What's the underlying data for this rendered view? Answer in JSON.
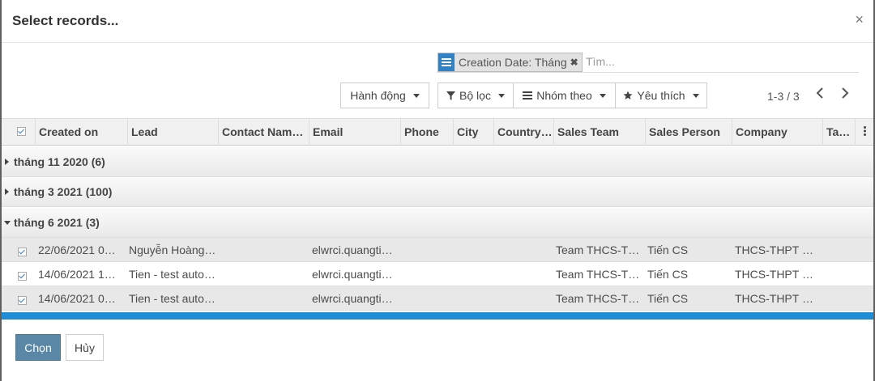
{
  "dialog": {
    "title": "Select records...",
    "close_glyph": "×"
  },
  "search": {
    "facet_label": "Creation Date: Tháng",
    "facet_remove": "✖",
    "placeholder": "Tìm..."
  },
  "toolbar": {
    "action": "Hành động",
    "filter": "Bộ lọc",
    "group_by": "Nhóm theo",
    "favorites": "Yêu thích"
  },
  "pager": {
    "value": "1-3 / 3",
    "prev": "‹",
    "next": "›"
  },
  "columns": [
    "Created on",
    "Lead",
    "Contact Name…",
    "Email",
    "Phone",
    "City",
    "Country…",
    "Sales Team",
    "Sales Person",
    "Company",
    "Ta…"
  ],
  "groups": [
    {
      "label": "tháng 11 2020 (6)",
      "expanded": false
    },
    {
      "label": "tháng 3 2021 (100)",
      "expanded": false
    },
    {
      "label": "tháng 6 2021 (3)",
      "expanded": true
    }
  ],
  "rows": [
    {
      "selected": true,
      "created_on": "22/06/2021 0…",
      "lead": "Nguyễn Hoàng…",
      "email": "elwrci.quangti…",
      "sales_team": "Team THCS-T…",
      "sales_person": "Tiến CS",
      "company": "THCS-THPT B…"
    },
    {
      "selected": true,
      "created_on": "14/06/2021 1…",
      "lead": "Tien - test auto…",
      "email": "elwrci.quangti…",
      "sales_team": "Team THCS-T…",
      "sales_person": "Tiến CS",
      "company": "THCS-THPT B…"
    },
    {
      "selected": true,
      "created_on": "14/06/2021 0…",
      "lead": "Tien - test auto…",
      "email": "elwrci.quangti…",
      "sales_team": "Team THCS-T…",
      "sales_person": "Tiến CS",
      "company": "THCS-THPT B…"
    }
  ],
  "footer": {
    "select": "Chọn",
    "cancel": "Hủy"
  },
  "colors": {
    "accent": "#1f8dd6",
    "primary_button": "#5987a5",
    "facet_icon": "#3182c4"
  },
  "icons": [
    "close-icon",
    "facet-list-icon",
    "facet-remove-icon",
    "filter-icon",
    "list-icon",
    "star-icon",
    "chevron-left-icon",
    "chevron-right-icon",
    "kebab-menu-icon"
  ]
}
